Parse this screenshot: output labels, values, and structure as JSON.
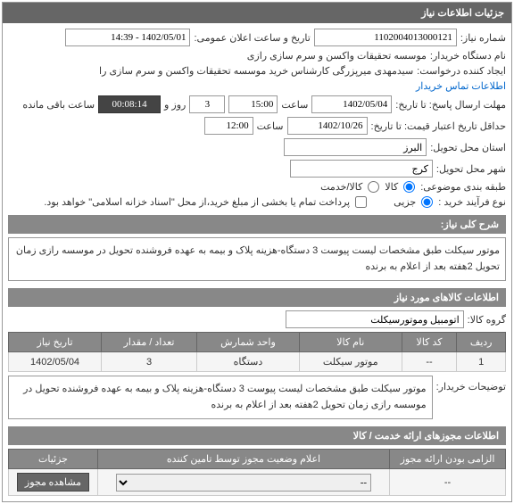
{
  "header": {
    "title": "جزئیات اطلاعات نیاز"
  },
  "fields": {
    "niaz_no_label": "شماره نیاز:",
    "niaz_no": "1102004013000121",
    "announce_label": "تاریخ و ساعت اعلان عمومی:",
    "announce": "1402/05/01 - 14:39",
    "buyer_org_label": "نام دستگاه خریدار:",
    "buyer_org": "موسسه تحقیقات واکسن و سرم سازی رازی",
    "creator_label": "ایجاد کننده درخواست:",
    "creator": "سیدمهدی میرپزرگی کارشناس خرید موسسه تحقیقات واکسن و سرم سازی را",
    "contact_link": "اطلاعات تماس خریدار",
    "reply_deadline_label": "مهلت ارسال پاسخ: تا تاریخ:",
    "reply_deadline_date": "1402/05/04",
    "saat_label": "ساعت",
    "reply_deadline_time": "15:00",
    "days_label": "روز و",
    "days": "3",
    "remain_label": "ساعت باقی مانده",
    "remain_time": "00:08:14",
    "min_valid_label": "حداقل تاریخ اعتبار قیمت: تا تاریخ:",
    "min_valid_date": "1402/10/26",
    "min_valid_time": "12:00",
    "province_label": "استان محل تحویل:",
    "province": "البرز",
    "city_label": "شهر محل تحویل:",
    "city": "کرج",
    "category_label": "طبقه بندی موضوعی:",
    "cat_kala": "کالا",
    "cat_khadamat": "کالا/خدمت",
    "buy_type_label": "نوع فرآیند خرید :",
    "buy_type_partial": "جزیی",
    "buy_type_note": "پرداخت تمام یا بخشی از مبلغ خرید،از محل \"اسناد خزانه اسلامی\" خواهد بود."
  },
  "desc": {
    "header": "شرح کلی نیاز:",
    "text": "موتور سیکلت طبق مشخصات لیست پیوست 3 دستگاه-هزینه پلاک و بیمه به عهده فروشنده تحویل در موسسه رازی زمان تحویل 2هفته بعد از اعلام به برنده"
  },
  "items": {
    "header": "اطلاعات کالاهای مورد نیاز",
    "group_label": "گروه کالا:",
    "group": "اتومبیل وموتورسیکلت",
    "cols": {
      "row": "ردیف",
      "code": "کد کالا",
      "name": "نام کالا",
      "unit": "واحد شمارش",
      "qty": "تعداد / مقدار",
      "date": "تاریخ نیاز"
    },
    "rows": [
      {
        "row": "1",
        "code": "--",
        "name": "موتور سیکلت",
        "unit": "دستگاه",
        "qty": "3",
        "date": "1402/05/04"
      }
    ],
    "buyer_note_label": "توضیحات خریدار:",
    "buyer_note": "موتور سیکلت طبق مشخصات لیست پیوست 3 دستگاه-هزینه پلاک و بیمه به عهده فروشنده تحویل در موسسه رازی زمان تحویل 2هفته بعد از اعلام به برنده"
  },
  "permits": {
    "header": "اطلاعات مجوزهای ارائه خدمت / کالا",
    "cols": {
      "mandatory": "الزامی بودن ارائه مجوز",
      "status": "اعلام وضعیت مجوز توسط تامین کننده",
      "details": "جزئیات"
    },
    "row": {
      "mandatory": "--",
      "status": "--",
      "btn": "مشاهده مجوز"
    }
  }
}
